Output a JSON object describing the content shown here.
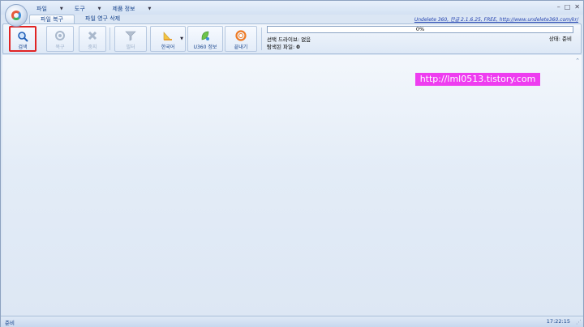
{
  "menu": {
    "items": [
      {
        "label": "파일"
      },
      {
        "label": "도구"
      },
      {
        "label": "제품 정보"
      }
    ]
  },
  "window_controls": {
    "minimize": "–",
    "restore": "□",
    "close": "✕"
  },
  "tabs": [
    {
      "label": "파일 복구",
      "active": true
    },
    {
      "label": "파일 영구 삭제",
      "active": false
    }
  ],
  "header_link": "Undelete 360, 한글 2.1.6.25, FREE, http://www.undelete360.com/kr/",
  "toolbar": {
    "buttons": [
      {
        "label": "검색",
        "icon": "search-icon",
        "enabled": true,
        "highlighted": true
      },
      {
        "label": "복구",
        "icon": "recover-icon",
        "enabled": false
      },
      {
        "label": "중지",
        "icon": "stop-icon",
        "enabled": false
      },
      {
        "label": "필터",
        "icon": "filter-icon",
        "enabled": false
      },
      {
        "label": "한국어",
        "icon": "language-icon",
        "enabled": true,
        "dropdown": true
      },
      {
        "label": "U360 정보",
        "icon": "info-icon",
        "enabled": true
      },
      {
        "label": "끝내기",
        "icon": "exit-icon",
        "enabled": true
      }
    ]
  },
  "progress": {
    "value": 0,
    "text": "0%"
  },
  "selected_drive": "선택 드라이브: 없음",
  "found_files": {
    "label": "탐색된 파일:",
    "value": "0"
  },
  "status": "상태: 준비",
  "watermark": "http://lml0513.tistory.com",
  "statusbar": {
    "left": "준비",
    "right": "17:22:15"
  },
  "colors": {
    "accent": "#15428b",
    "highlight": "#e02424",
    "watermark_bg": "#ee3df0"
  }
}
